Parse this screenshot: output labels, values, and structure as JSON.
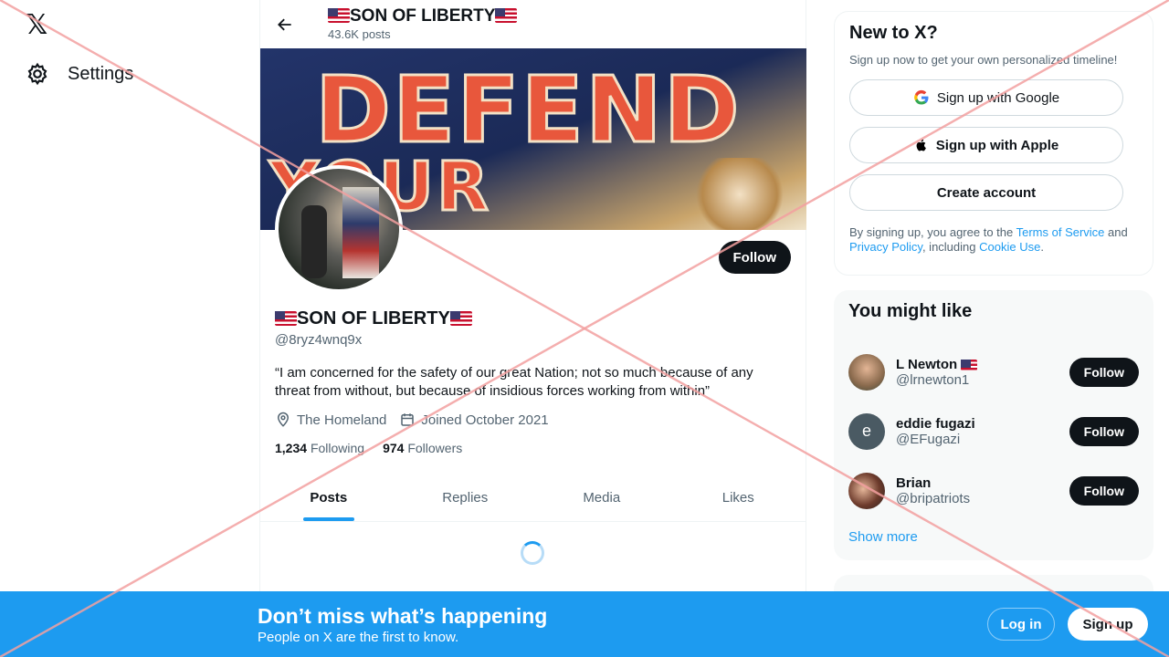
{
  "nav": {
    "settings_label": "Settings"
  },
  "header": {
    "name": "SON OF LIBERTY",
    "posts": "43.6K posts"
  },
  "banner": {
    "line1": "DEFEND",
    "line2": "YOUR COUNTRY"
  },
  "profile": {
    "name": "SON OF LIBERTY",
    "handle": "@8ryz4wnq9x",
    "bio": "“I am concerned for the safety of our great Nation; not so much because of any threat from without, but because of insidious forces working from within”",
    "location": "The Homeland",
    "joined": "Joined October 2021",
    "following_count": "1,234",
    "following_label": "Following",
    "followers_count": "974",
    "followers_label": "Followers",
    "follow_label": "Follow"
  },
  "tabs": [
    "Posts",
    "Replies",
    "Media",
    "Likes"
  ],
  "new_to_x": {
    "title": "New to X?",
    "subtitle": "Sign up now to get your own personalized timeline!",
    "google": "Sign up with Google",
    "apple": "Sign up with Apple",
    "create": "Create account",
    "terms_pre": "By signing up, you agree to the ",
    "terms_link": "Terms of Service",
    "terms_mid": " and ",
    "privacy_link": "Privacy Policy",
    "terms_mid2": ", including ",
    "cookie_link": "Cookie Use",
    "terms_end": "."
  },
  "might_like": {
    "title": "You might like",
    "users": [
      {
        "name": "L Newton",
        "handle": "@lrnewton1",
        "follow": "Follow"
      },
      {
        "name": "eddie fugazi",
        "handle": "@EFugazi",
        "follow": "Follow",
        "initial": "e"
      },
      {
        "name": "Brian",
        "handle": "@bripatriots",
        "follow": "Follow"
      }
    ],
    "show_more": "Show more"
  },
  "bottom": {
    "title": "Don’t miss what’s happening",
    "subtitle": "People on X are the first to know.",
    "login": "Log in",
    "signup": "Sign up"
  },
  "colors": {
    "accent": "#1d9bf0",
    "text": "#0f1419",
    "muted": "#536471"
  }
}
